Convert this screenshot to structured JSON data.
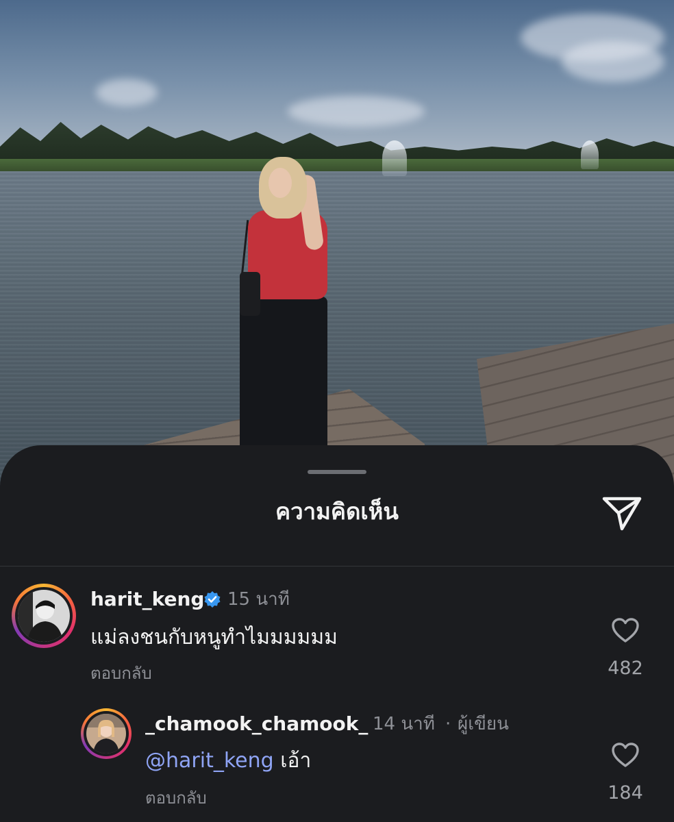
{
  "sheet": {
    "title": "ความคิดเห็น",
    "share_icon": "paper-plane-icon"
  },
  "comments": [
    {
      "username": "harit_keng",
      "verified": true,
      "time": "15 นาที",
      "text": "แม่ลงชนกับหนูทำไมมมมมม",
      "reply_label": "ตอบกลับ",
      "likes": "482"
    },
    {
      "username": "_chamook_chamook_",
      "time": "14 นาที",
      "author_separator": "·",
      "author_label": "ผู้เขียน",
      "mention": "@harit_keng",
      "text": "เอ้า",
      "reply_label": "ตอบกลับ",
      "likes": "184"
    }
  ],
  "colors": {
    "sheet_bg": "#1b1c1f",
    "text_primary": "#f2f2f2",
    "text_secondary": "#8e9096",
    "mention": "#8fa4f5",
    "verified_badge": "#3897f0"
  }
}
